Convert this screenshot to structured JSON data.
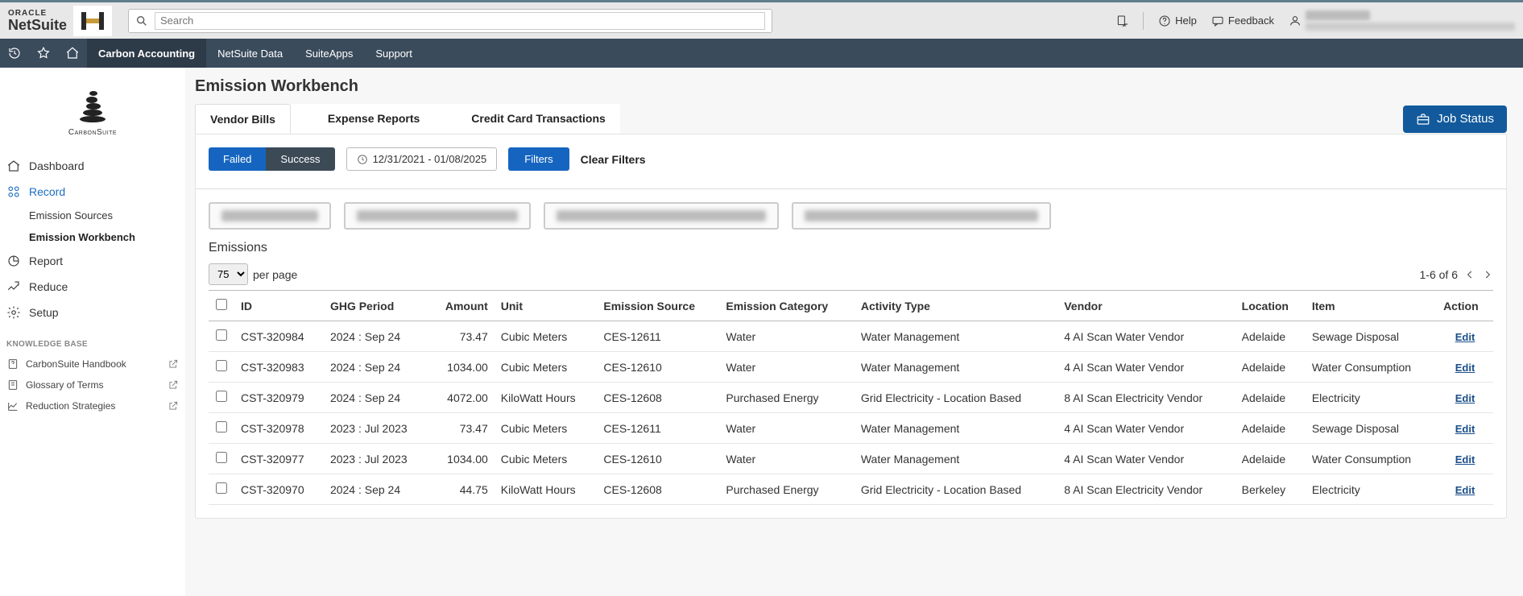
{
  "brand": {
    "vendor": "ORACLE",
    "product": "NetSuite"
  },
  "search": {
    "placeholder": "Search"
  },
  "topright": {
    "help": "Help",
    "feedback": "Feedback"
  },
  "nav": {
    "items": [
      "Carbon Accounting",
      "NetSuite Data",
      "SuiteApps",
      "Support"
    ],
    "activeIndex": 0
  },
  "sidebar": {
    "logoText": "CarbonSuite",
    "items": [
      {
        "label": "Dashboard"
      },
      {
        "label": "Record",
        "active": true
      },
      {
        "label": "Report"
      },
      {
        "label": "Reduce"
      },
      {
        "label": "Setup"
      }
    ],
    "subitems": [
      {
        "label": "Emission Sources"
      },
      {
        "label": "Emission Workbench",
        "bold": true
      }
    ],
    "kbTitle": "KNOWLEDGE BASE",
    "kb": [
      {
        "label": "CarbonSuite Handbook"
      },
      {
        "label": "Glossary of Terms"
      },
      {
        "label": "Reduction Strategies"
      }
    ]
  },
  "page": {
    "title": "Emission Workbench"
  },
  "tabs2": [
    "Vendor Bills",
    "Expense Reports",
    "Credit Card Transactions"
  ],
  "jobStatusLabel": "Job Status",
  "filters": {
    "failed": "Failed",
    "success": "Success",
    "dateRange": "12/31/2021 - 01/08/2025",
    "filtersBtn": "Filters",
    "clear": "Clear Filters"
  },
  "emissions": {
    "heading": "Emissions",
    "perPageValue": "75",
    "perPageLabel": "per page",
    "pagerText": "1-6 of 6",
    "headers": {
      "id": "ID",
      "ghg": "GHG Period",
      "amount": "Amount",
      "unit": "Unit",
      "source": "Emission Source",
      "category": "Emission Category",
      "activity": "Activity Type",
      "vendor": "Vendor",
      "location": "Location",
      "item": "Item",
      "action": "Action"
    },
    "editLabel": "Edit",
    "rows": [
      {
        "id": "CST-320984",
        "ghg": "2024 : Sep 24",
        "amount": "73.47",
        "unit": "Cubic Meters",
        "source": "CES-12611",
        "category": "Water",
        "activity": "Water Management",
        "vendor": "4 AI Scan Water Vendor",
        "location": "Adelaide",
        "item": "Sewage Disposal"
      },
      {
        "id": "CST-320983",
        "ghg": "2024 : Sep 24",
        "amount": "1034.00",
        "unit": "Cubic Meters",
        "source": "CES-12610",
        "category": "Water",
        "activity": "Water Management",
        "vendor": "4 AI Scan Water Vendor",
        "location": "Adelaide",
        "item": "Water Consumption"
      },
      {
        "id": "CST-320979",
        "ghg": "2024 : Sep 24",
        "amount": "4072.00",
        "unit": "KiloWatt Hours",
        "source": "CES-12608",
        "category": "Purchased Energy",
        "activity": "Grid Electricity - Location Based",
        "vendor": "8 AI Scan Electricity Vendor",
        "location": "Adelaide",
        "item": "Electricity"
      },
      {
        "id": "CST-320978",
        "ghg": "2023 : Jul 2023",
        "amount": "73.47",
        "unit": "Cubic Meters",
        "source": "CES-12611",
        "category": "Water",
        "activity": "Water Management",
        "vendor": "4 AI Scan Water Vendor",
        "location": "Adelaide",
        "item": "Sewage Disposal"
      },
      {
        "id": "CST-320977",
        "ghg": "2023 : Jul 2023",
        "amount": "1034.00",
        "unit": "Cubic Meters",
        "source": "CES-12610",
        "category": "Water",
        "activity": "Water Management",
        "vendor": "4 AI Scan Water Vendor",
        "location": "Adelaide",
        "item": "Water Consumption"
      },
      {
        "id": "CST-320970",
        "ghg": "2024 : Sep 24",
        "amount": "44.75",
        "unit": "KiloWatt Hours",
        "source": "CES-12608",
        "category": "Purchased Energy",
        "activity": "Grid Electricity - Location Based",
        "vendor": "8 AI Scan Electricity Vendor",
        "location": "Berkeley",
        "item": "Electricity"
      }
    ]
  }
}
